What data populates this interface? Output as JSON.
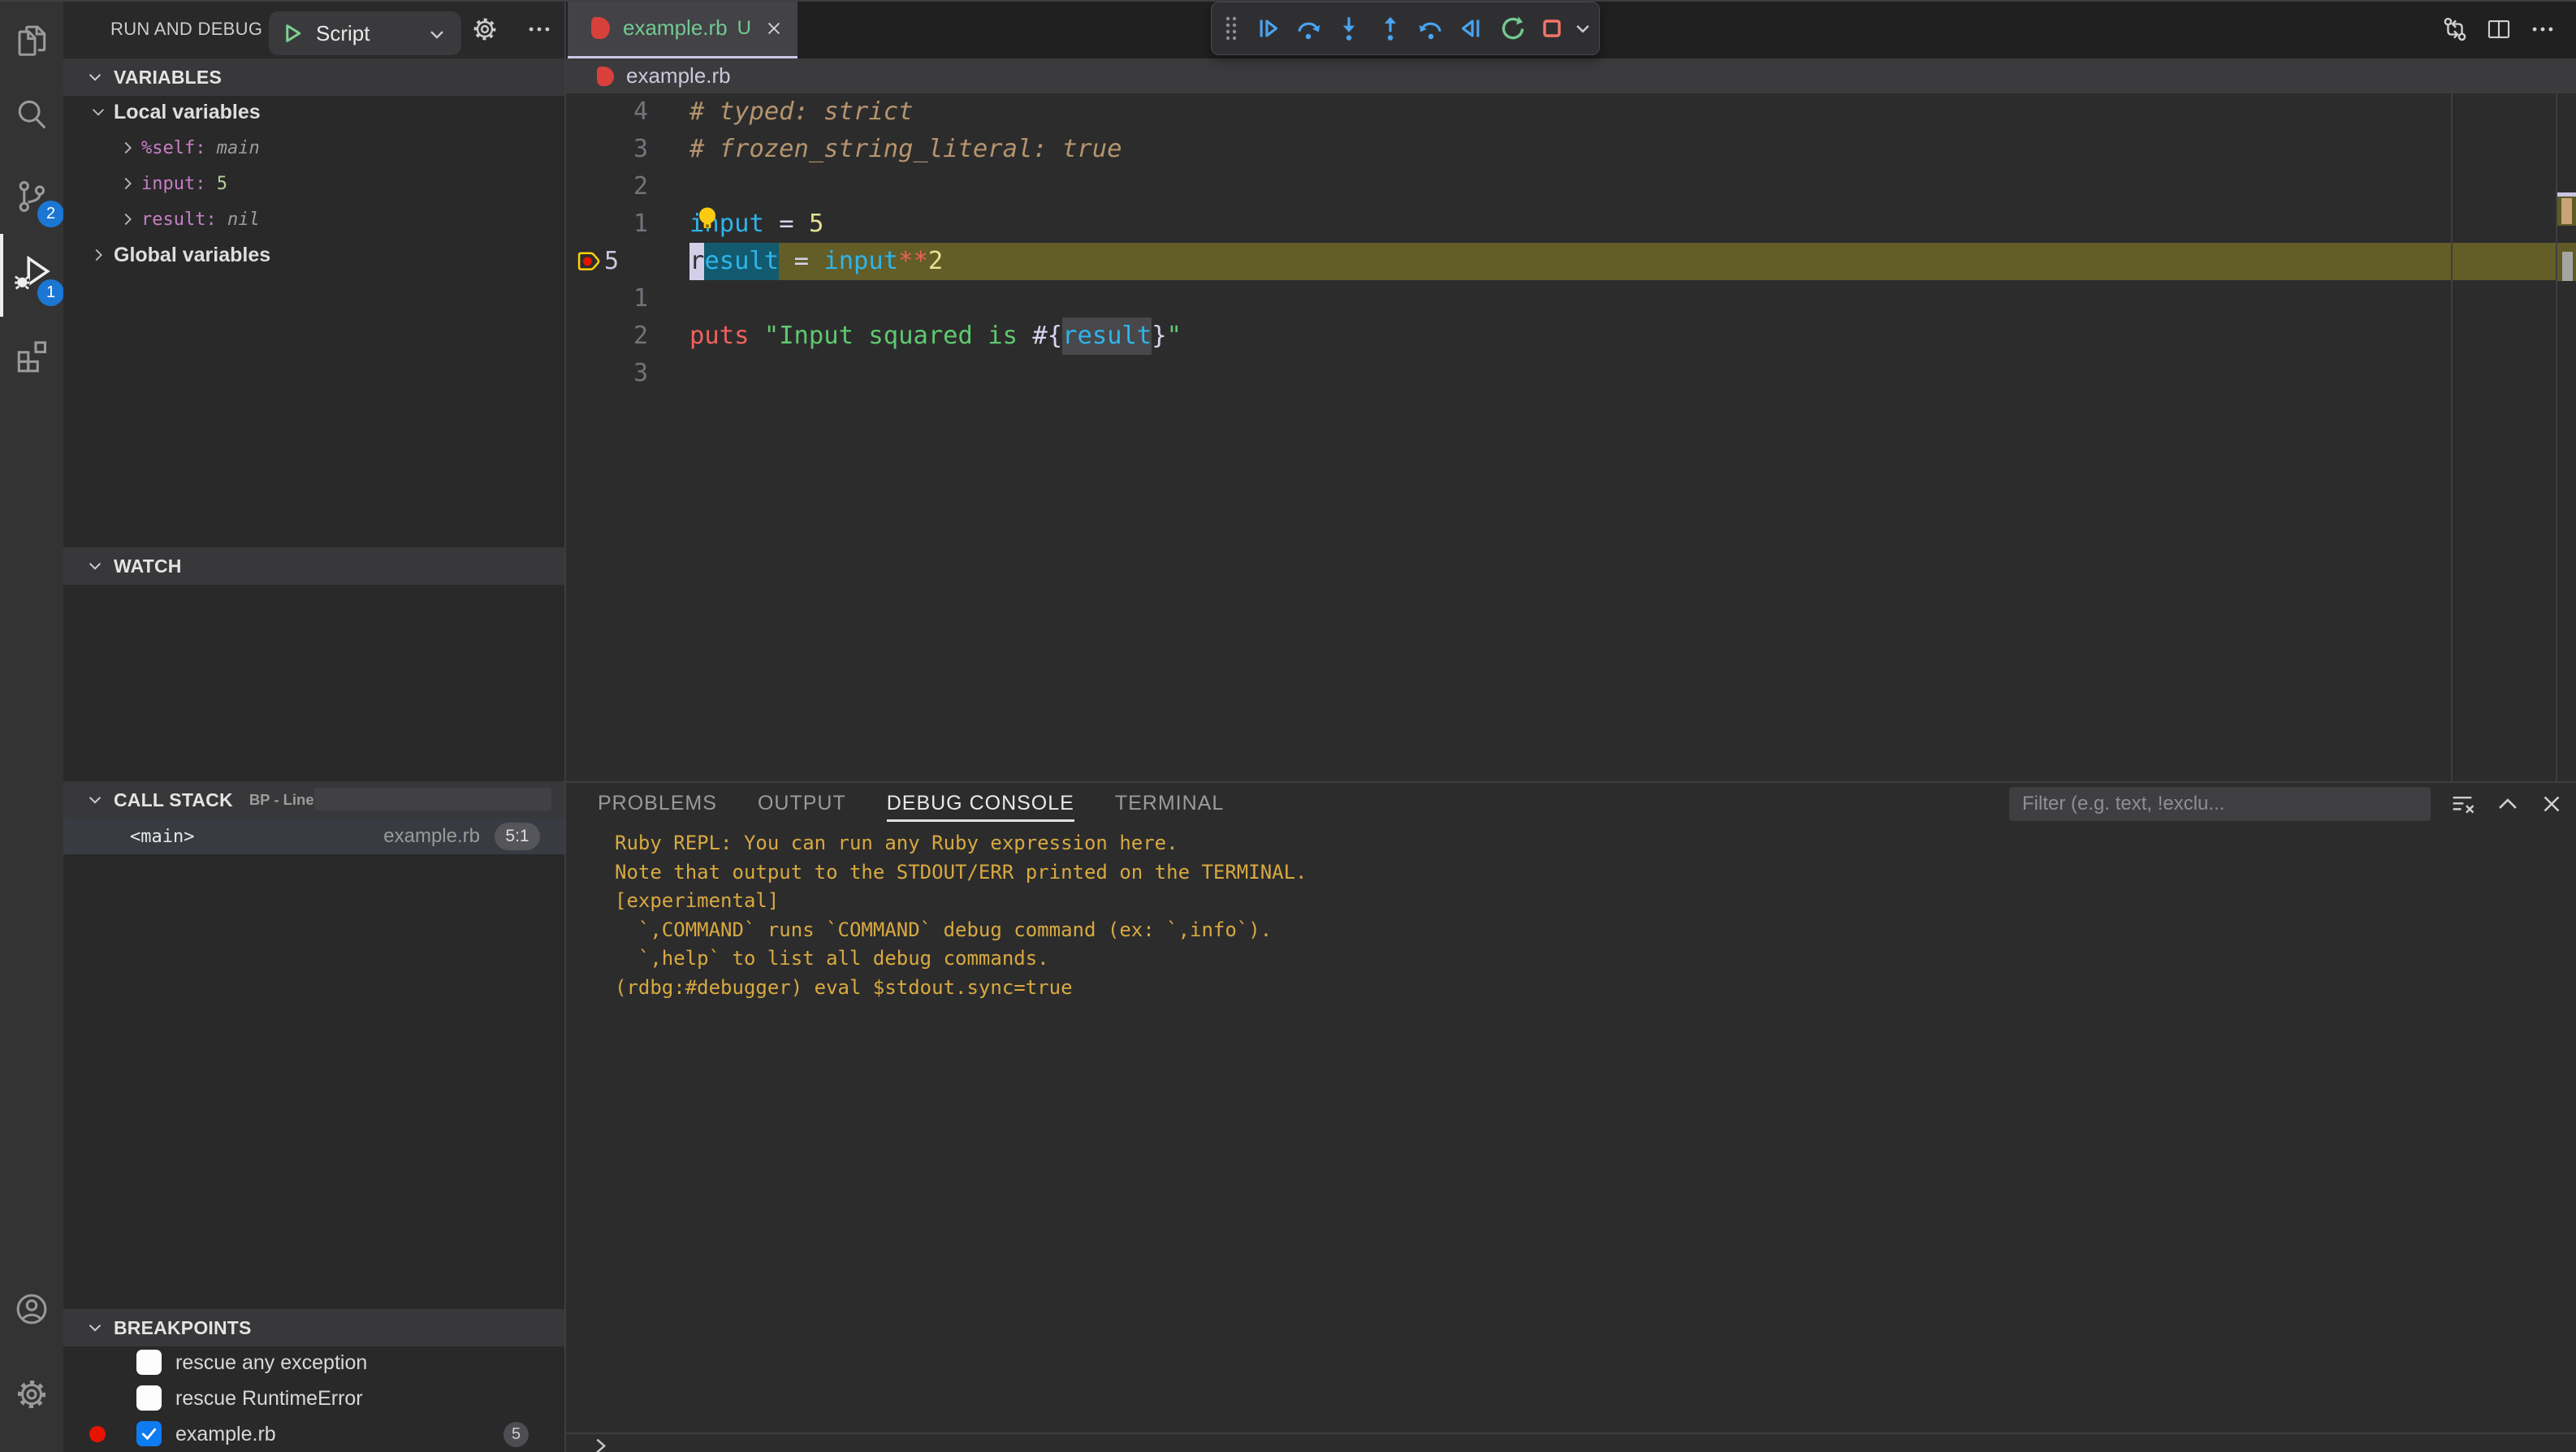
{
  "activity_bar": {
    "items": [
      {
        "id": "explorer",
        "label": "Explorer"
      },
      {
        "id": "search",
        "label": "Search"
      },
      {
        "id": "source-control",
        "label": "Source Control",
        "badge": "2"
      },
      {
        "id": "run-and-debug",
        "label": "Run and Debug",
        "badge": "1",
        "active": true
      },
      {
        "id": "extensions",
        "label": "Extensions"
      }
    ],
    "bottom_items": [
      {
        "id": "accounts",
        "label": "Accounts"
      },
      {
        "id": "settings",
        "label": "Manage"
      }
    ]
  },
  "sidebar": {
    "title": "RUN AND DEBUG",
    "launch_config": {
      "label": "Script"
    },
    "variables": {
      "header": "VARIABLES",
      "scopes": [
        {
          "label": "Local variables",
          "expanded": true,
          "items": [
            {
              "name": "%self:",
              "value": "main",
              "kind": "obj"
            },
            {
              "name": "input:",
              "value": "5",
              "kind": "num"
            },
            {
              "name": "result:",
              "value": "nil",
              "kind": "nil"
            }
          ]
        },
        {
          "label": "Global variables",
          "expanded": false,
          "items": []
        }
      ]
    },
    "watch": {
      "header": "WATCH"
    },
    "call_stack": {
      "header": "CALL STACK",
      "status": "BP - Line",
      "frames": [
        {
          "name": "<main>",
          "file": "example.rb",
          "position": "5:1"
        }
      ]
    },
    "breakpoints": {
      "header": "BREAKPOINTS",
      "items": [
        {
          "label": "rescue any exception",
          "checked": false,
          "kind": "exception"
        },
        {
          "label": "rescue RuntimeError",
          "checked": false,
          "kind": "exception"
        },
        {
          "label": "example.rb",
          "checked": true,
          "kind": "source",
          "badge": "5",
          "dot": true
        }
      ]
    }
  },
  "editor": {
    "tab": {
      "label": "example.rb",
      "git_status": "U"
    },
    "breadcrumb": "example.rb",
    "toolbar": [
      "drag-handle",
      "continue",
      "step-over",
      "step-into",
      "step-out",
      "step-back",
      "reverse-continue",
      "restart",
      "stop",
      "stop-dropdown"
    ],
    "code": {
      "language": "ruby",
      "cursor_position": "5:1",
      "lines": [
        {
          "num": "4",
          "tokens": [
            [
              "# typed: strict",
              "cm"
            ]
          ]
        },
        {
          "num": "3",
          "tokens": [
            [
              "# frozen_string_literal: true",
              "cm"
            ]
          ]
        },
        {
          "num": "2",
          "tokens": []
        },
        {
          "num": "1",
          "lightbulb": true,
          "tokens": [
            [
              "input",
              "vr"
            ],
            [
              " ",
              "pl"
            ],
            [
              "=",
              "op"
            ],
            [
              " ",
              "pl"
            ],
            [
              "5",
              "nm"
            ]
          ]
        },
        {
          "num": "5",
          "current": true,
          "breakpoint": true,
          "tokens": [
            [
              "r",
              "vr cur"
            ],
            [
              "esult",
              "vr sel"
            ],
            [
              " ",
              "pl"
            ],
            [
              "=",
              "op"
            ],
            [
              " ",
              "pl"
            ],
            [
              "input",
              "vr"
            ],
            [
              "**",
              "kw"
            ],
            [
              "2",
              "nm"
            ]
          ]
        },
        {
          "num": "1",
          "tokens": []
        },
        {
          "num": "2",
          "tokens": [
            [
              "puts",
              "fn"
            ],
            [
              " ",
              "pl"
            ],
            [
              "\"Input squared is ",
              "st"
            ],
            [
              "#{",
              "ip"
            ],
            [
              "result",
              "vr whl"
            ],
            [
              "}",
              "ip"
            ],
            [
              "\"",
              "st"
            ]
          ]
        },
        {
          "num": "3",
          "tokens": []
        }
      ]
    }
  },
  "panel": {
    "tabs": [
      {
        "label": "PROBLEMS"
      },
      {
        "label": "OUTPUT"
      },
      {
        "label": "DEBUG CONSOLE",
        "active": true
      },
      {
        "label": "TERMINAL"
      }
    ],
    "filter_placeholder": "Filter (e.g. text, !exclu...",
    "console_lines": [
      "Ruby REPL: You can run any Ruby expression here.",
      "Note that output to the STDOUT/ERR printed on the TERMINAL.",
      "[experimental]",
      "  `,COMMAND` runs `COMMAND` debug command (ex: `,info`).",
      "  `,help` to list all debug commands.",
      "(rdbg:#debugger) eval $stdout.sync=true"
    ]
  },
  "colors": {
    "accent_blue": "#4aa3ef",
    "restart_green": "#74c991",
    "stop_red": "#f4756a",
    "breakpoint_red": "#e51400",
    "debug_yellow": "#fdd00a",
    "git_untracked_green": "#73c991",
    "console_text": "#d8a940",
    "badge_blue": "#1b76d4",
    "current_line": "#635d28",
    "selection_teal": "#135a6e",
    "cursor_block": "#d3cfe9",
    "ruby_icon_red": "#d8403c"
  }
}
